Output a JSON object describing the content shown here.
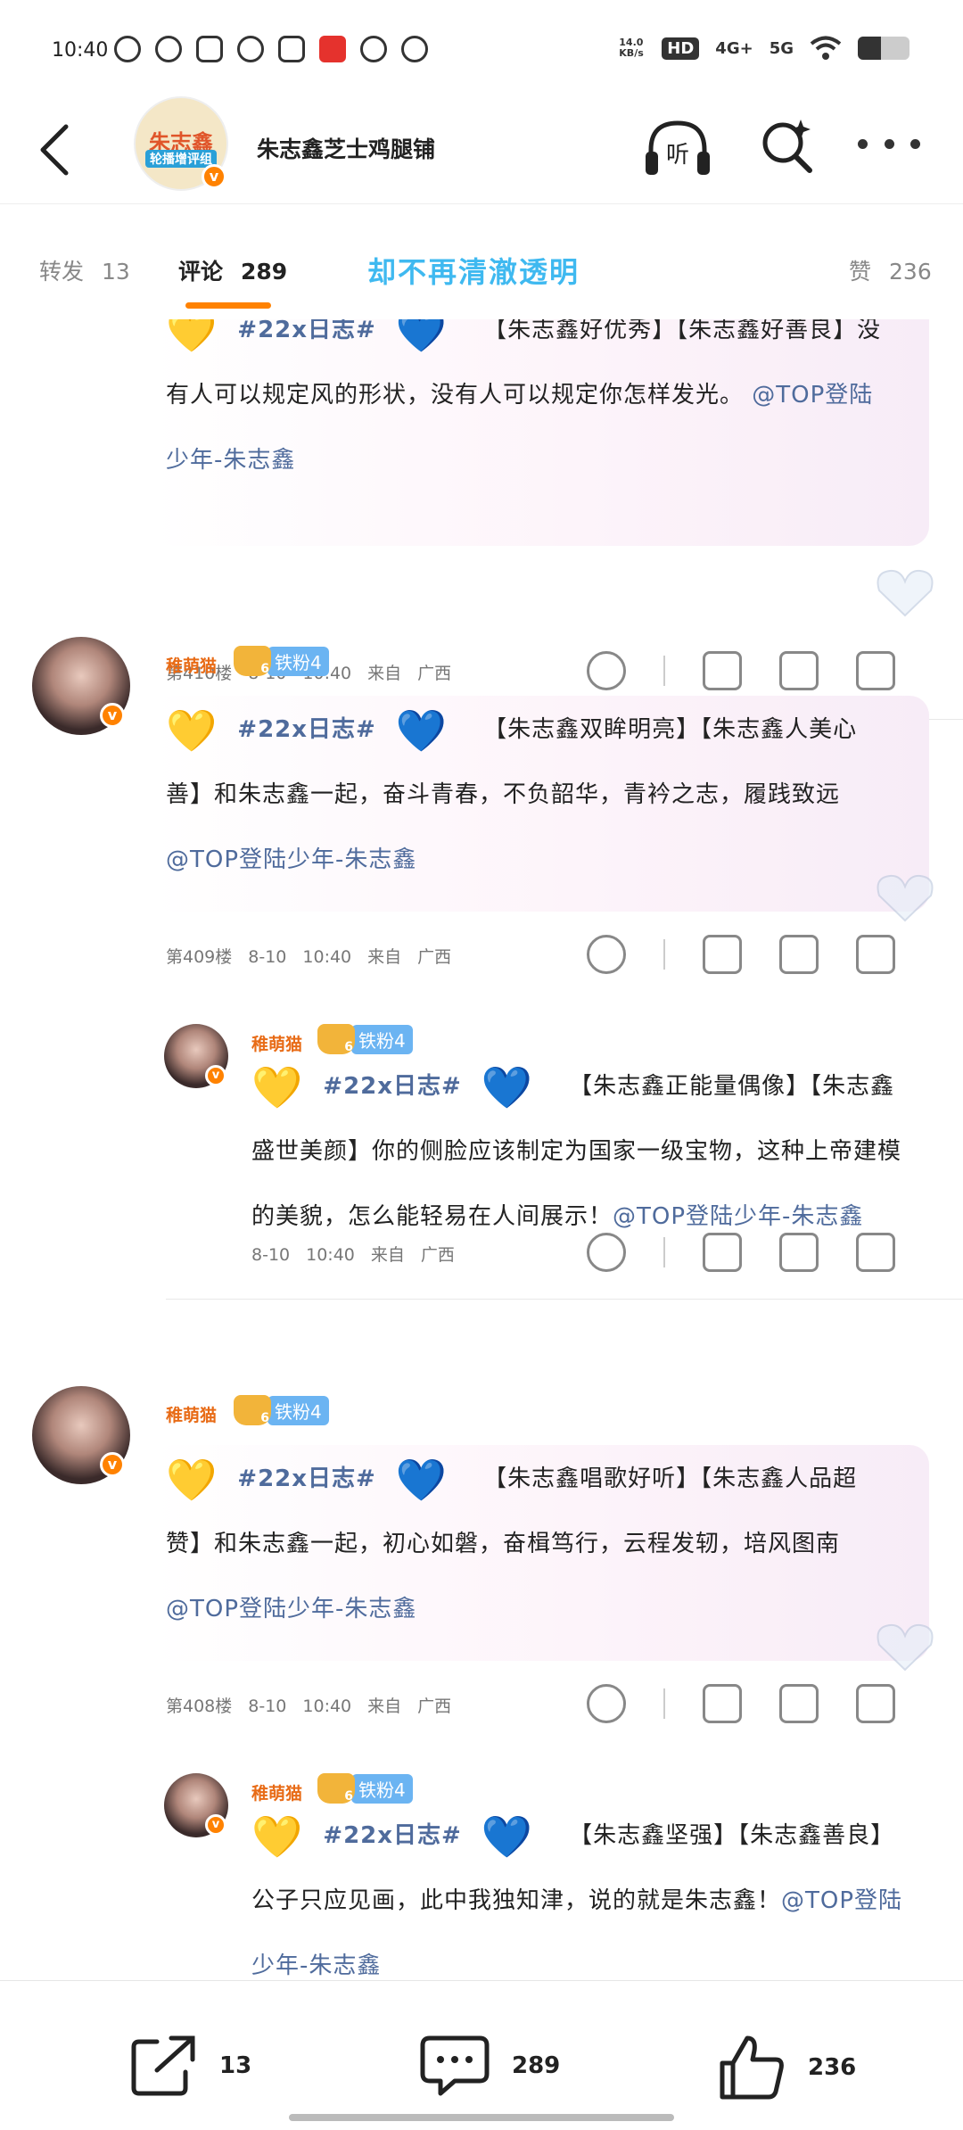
{
  "status_bar": {
    "time": "10:40",
    "net_speed": "14.0 KB/s",
    "hd": "HD",
    "signal1": "4G+",
    "signal2": "5G",
    "battery_level": 0.45
  },
  "nav": {
    "title": "朱志鑫芝士鸡腿铺",
    "avatar_text1": "朱志鑫",
    "avatar_text2": "轮播增评组"
  },
  "tabs": [
    {
      "label": "转发",
      "count": "13"
    },
    {
      "label": "评论",
      "count": "289"
    },
    {
      "label": "赞",
      "count": "236"
    }
  ],
  "overlay_text": "却不再清澈透明",
  "comments": [
    {
      "name": "稚萌猫",
      "fan": "铁粉4",
      "tag": "#22x日志#",
      "lines": [
        "【朱志鑫好优秀】【朱志鑫好善良】没",
        "有人可以规定风的形状，没有人可以规定你怎样发光。",
        "少年-朱志鑫"
      ],
      "at": "@TOP登陆",
      "floor": "第410楼",
      "date": "8-10",
      "time": "10:40",
      "from": "来自",
      "location": "广西"
    },
    {
      "name": "稚萌猫",
      "fan": "铁粉4",
      "tag": "#22x日志#",
      "lines": [
        "【朱志鑫双眸明亮】【朱志鑫人美心",
        "善】和朱志鑫一起，奋斗青春，不负韶华，青衿之志，履践致远",
        "@TOP登陆少年-朱志鑫"
      ],
      "floor": "第409楼",
      "date": "8-10",
      "time": "10:40",
      "from": "来自",
      "location": "广西"
    },
    {
      "name": "稚萌猫",
      "fan": "铁粉4",
      "tag": "#22x日志#",
      "lines": [
        "【朱志鑫正能量偶像】【朱志鑫",
        "盛世美颜】你的侧脸应该制定为国家一级宝物，这种上帝建模",
        "的美貌，怎么能轻易在人间展示！"
      ],
      "at": "@TOP登陆少年-朱志鑫",
      "date": "8-10",
      "time": "10:40",
      "from": "来自",
      "location": "广西"
    },
    {
      "name": "稚萌猫",
      "fan": "铁粉4",
      "tag": "#22x日志#",
      "lines": [
        "【朱志鑫唱歌好听】【朱志鑫人品超",
        "赞】和朱志鑫一起，初心如磐，奋楫笃行，云程发轫，培风图南",
        "@TOP登陆少年-朱志鑫"
      ],
      "floor": "第408楼",
      "date": "8-10",
      "time": "10:40",
      "from": "来自",
      "location": "广西"
    },
    {
      "name": "稚萌猫",
      "fan": "铁粉4",
      "tag": "#22x日志#",
      "lines": [
        "【朱志鑫坚强】【朱志鑫善良】",
        "公子只应见画，此中我独知津，说的就是朱志鑫！",
        "少年-朱志鑫"
      ],
      "at": "@TOP登陆"
    }
  ],
  "bottom_bar": {
    "repost_count": "13",
    "comment_count": "289",
    "like_count": "236"
  },
  "colors": {
    "accent": "#ff8200",
    "link": "#4f6b9c",
    "name": "#e86b16",
    "overlay": "#3fb9f0"
  }
}
